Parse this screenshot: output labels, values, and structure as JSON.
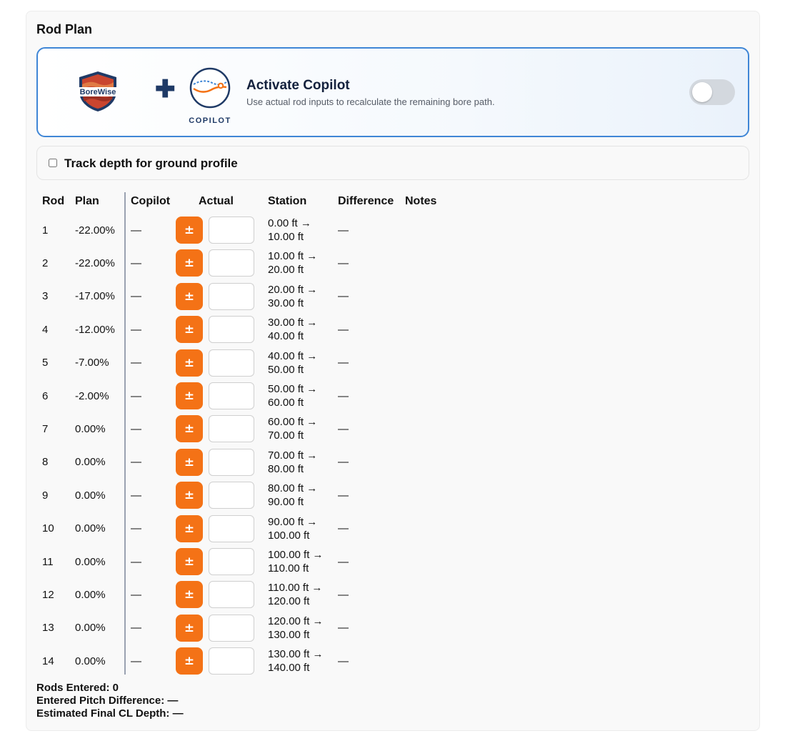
{
  "panel": {
    "title": "Rod Plan"
  },
  "copilot": {
    "brand_logo": "borewise-shield-logo",
    "brand_text": "BoreWise",
    "plus_icon": "plus-icon",
    "logo_label": "COPILOT",
    "heading": "Activate Copilot",
    "description": "Use actual rod inputs to recalculate the remaining bore path.",
    "toggle_on": false
  },
  "track_depth": {
    "label": "Track depth for ground profile",
    "checked": false
  },
  "table": {
    "headers": {
      "rod": "Rod",
      "plan": "Plan",
      "copilot": "Copilot",
      "actual": "Actual",
      "station": "Station",
      "difference": "Difference",
      "notes": "Notes"
    },
    "adjust_label": "±",
    "rows": [
      {
        "rod": "1",
        "plan": "-22.00%",
        "copilot": "—",
        "station_from": "0.00 ft →",
        "station_to": "10.00 ft",
        "difference": "—"
      },
      {
        "rod": "2",
        "plan": "-22.00%",
        "copilot": "—",
        "station_from": "10.00 ft →",
        "station_to": "20.00 ft",
        "difference": "—"
      },
      {
        "rod": "3",
        "plan": "-17.00%",
        "copilot": "—",
        "station_from": "20.00 ft →",
        "station_to": "30.00 ft",
        "difference": "—"
      },
      {
        "rod": "4",
        "plan": "-12.00%",
        "copilot": "—",
        "station_from": "30.00 ft →",
        "station_to": "40.00 ft",
        "difference": "—"
      },
      {
        "rod": "5",
        "plan": "-7.00%",
        "copilot": "—",
        "station_from": "40.00 ft →",
        "station_to": "50.00 ft",
        "difference": "—"
      },
      {
        "rod": "6",
        "plan": "-2.00%",
        "copilot": "—",
        "station_from": "50.00 ft →",
        "station_to": "60.00 ft",
        "difference": "—"
      },
      {
        "rod": "7",
        "plan": "0.00%",
        "copilot": "—",
        "station_from": "60.00 ft →",
        "station_to": "70.00 ft",
        "difference": "—"
      },
      {
        "rod": "8",
        "plan": "0.00%",
        "copilot": "—",
        "station_from": "70.00 ft →",
        "station_to": "80.00 ft",
        "difference": "—"
      },
      {
        "rod": "9",
        "plan": "0.00%",
        "copilot": "—",
        "station_from": "80.00 ft →",
        "station_to": "90.00 ft",
        "difference": "—"
      },
      {
        "rod": "10",
        "plan": "0.00%",
        "copilot": "—",
        "station_from": "90.00 ft →",
        "station_to": "100.00 ft",
        "difference": "—"
      },
      {
        "rod": "11",
        "plan": "0.00%",
        "copilot": "—",
        "station_from": "100.00 ft →",
        "station_to": "110.00 ft",
        "difference": "—"
      },
      {
        "rod": "12",
        "plan": "0.00%",
        "copilot": "—",
        "station_from": "110.00 ft →",
        "station_to": "120.00 ft",
        "difference": "—"
      },
      {
        "rod": "13",
        "plan": "0.00%",
        "copilot": "—",
        "station_from": "120.00 ft →",
        "station_to": "130.00 ft",
        "difference": "—"
      },
      {
        "rod": "14",
        "plan": "0.00%",
        "copilot": "—",
        "station_from": "130.00 ft →",
        "station_to": "140.00 ft",
        "difference": "—"
      }
    ]
  },
  "summary": {
    "rods_entered": "Rods Entered: 0",
    "pitch_difference": "Entered Pitch Difference: —",
    "final_cl_depth": "Estimated Final CL Depth: —"
  },
  "colors": {
    "accent_orange": "#f47216",
    "card_border": "#3f86d6",
    "navy": "#1f3a66",
    "shield_red": "#b43b2b"
  }
}
